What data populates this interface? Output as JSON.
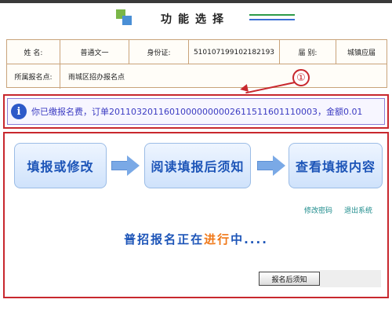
{
  "header": {
    "title": "功能选择"
  },
  "info": {
    "name_label": "姓 名:",
    "name_value": "普通文一",
    "id_label": "身份证:",
    "id_value": "510107199102182193",
    "session_label": "届 别:",
    "session_value": "城镇应届",
    "site_label": "所属报名点:",
    "site_value": "雨城区招办报名点"
  },
  "callout": {
    "marker": "①"
  },
  "notice": {
    "icon": "info-icon",
    "text": "你已缴报名费，订单20110320116010000000002611511601110003，金额0.01"
  },
  "steps": [
    {
      "label": "填报或修改"
    },
    {
      "label": "阅读填报后须知"
    },
    {
      "label": "查看填报内容"
    }
  ],
  "links": {
    "change_password": "修改密码",
    "logout": "退出系统"
  },
  "progress": {
    "prefix": "普招报名正在",
    "highlight": "进行",
    "suffix": "中...."
  },
  "buttons": {
    "after_notice": "报名后须知"
  },
  "colors": {
    "accent_red": "#c8282e",
    "link_blue": "#1d55b8",
    "highlight_orange": "#f07818"
  }
}
